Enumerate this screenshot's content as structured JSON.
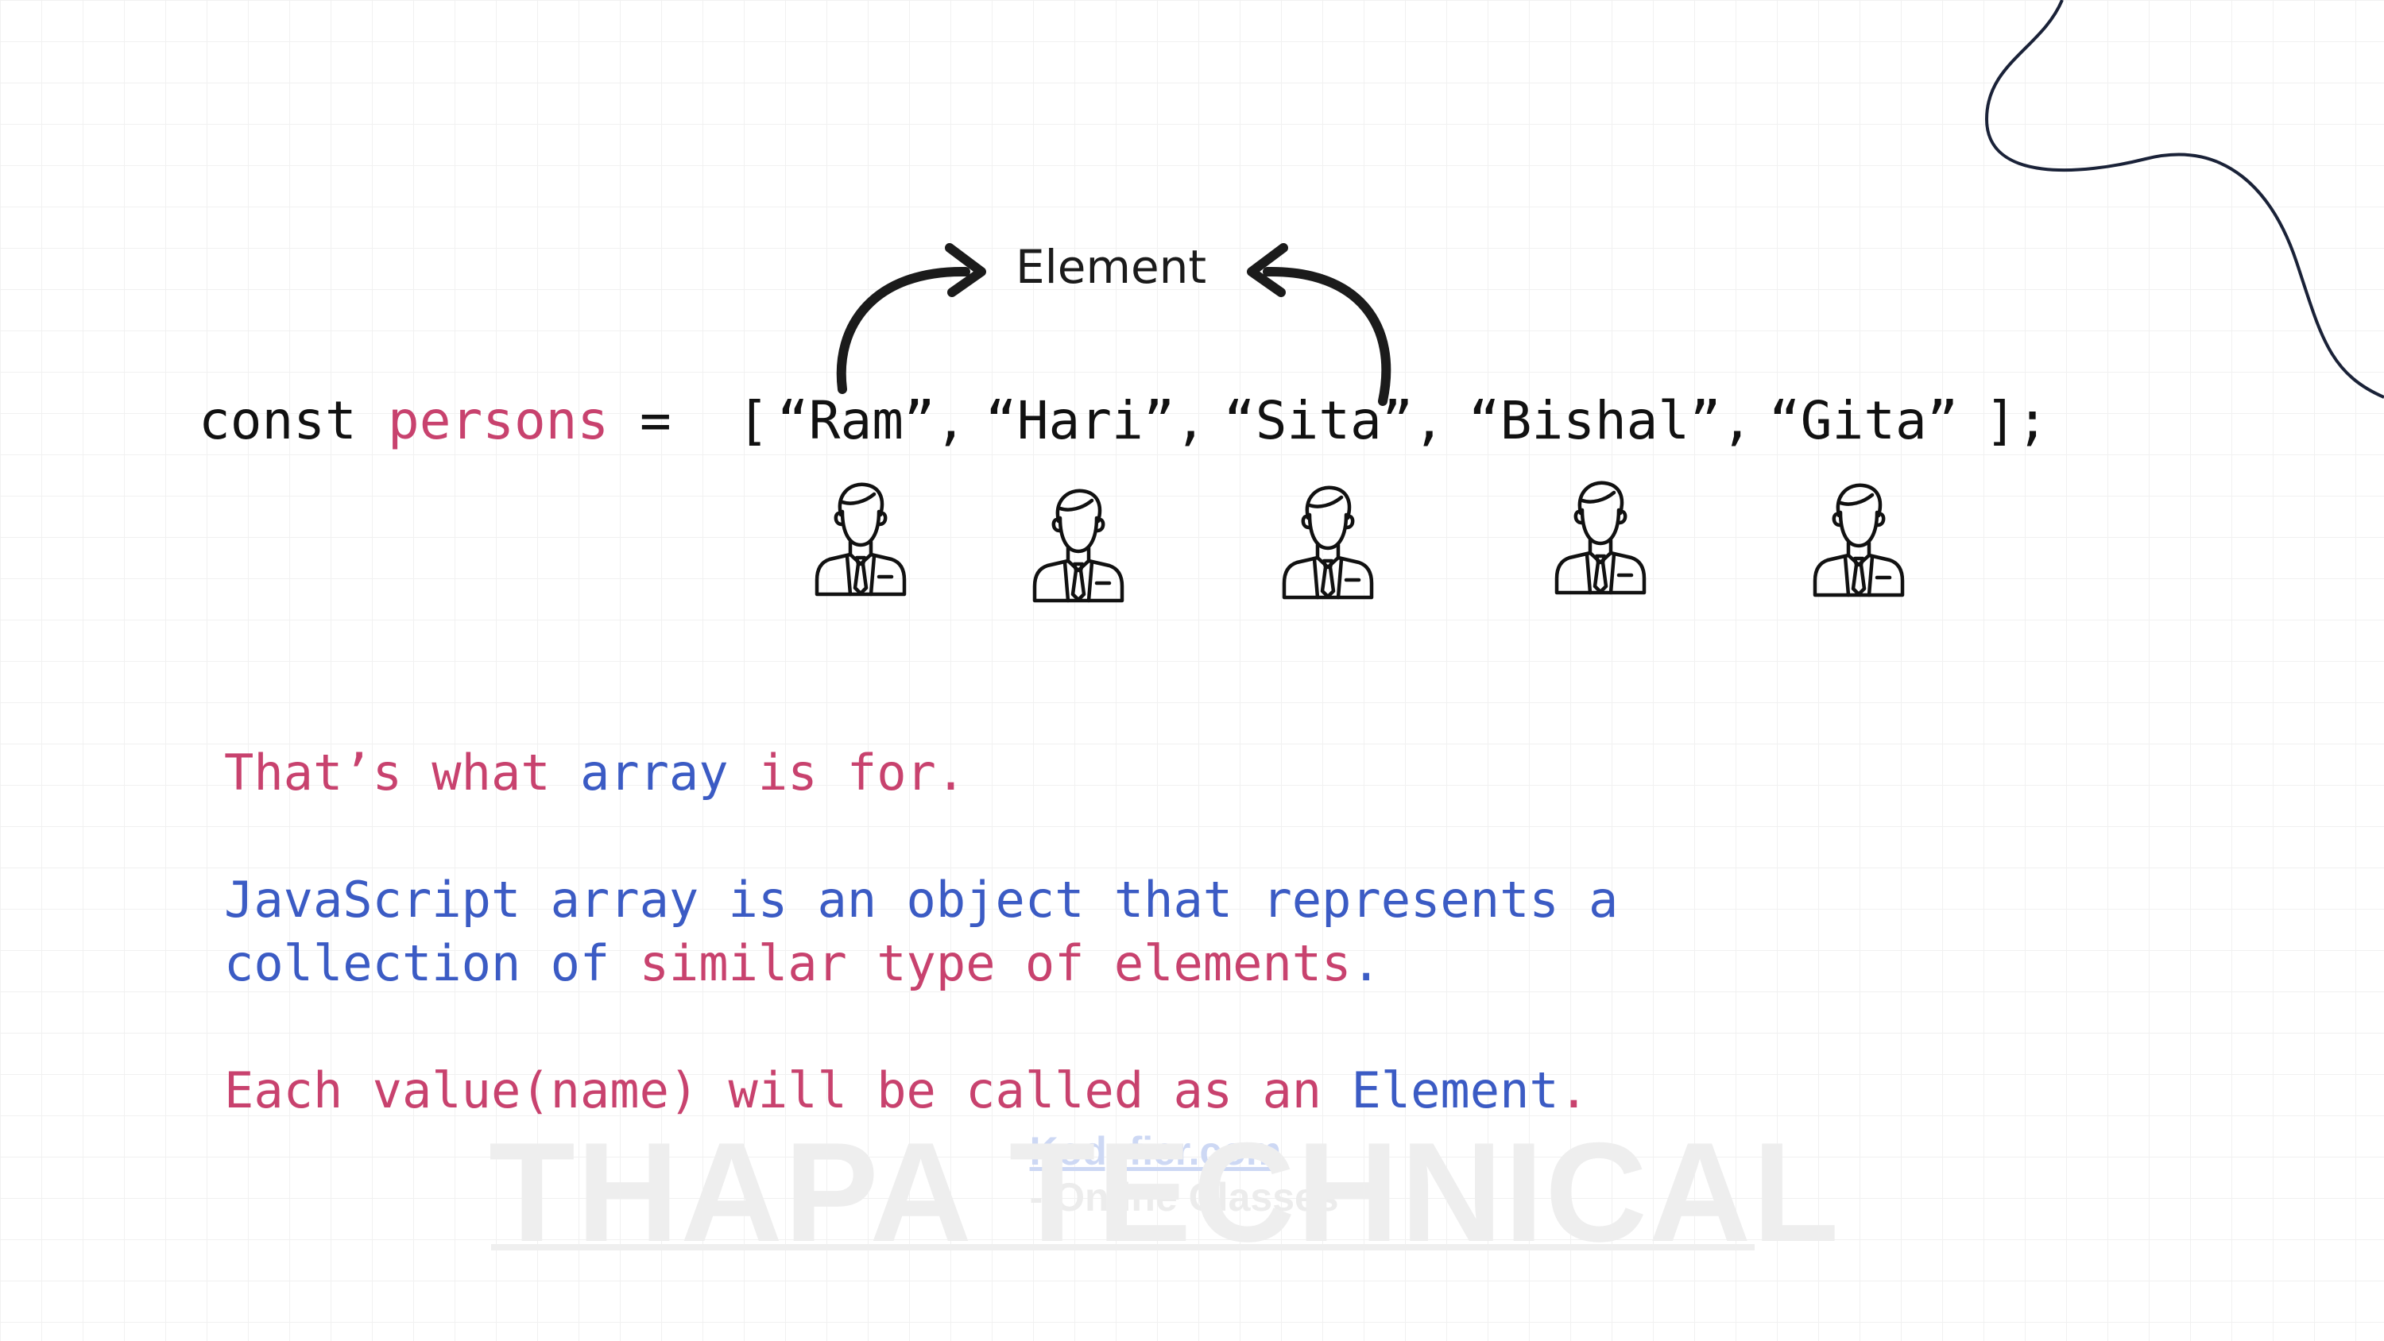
{
  "annotation": {
    "label": "Element"
  },
  "code_line": {
    "keyword": "const",
    "variable": "persons",
    "operator": "=",
    "open_bracket": "[",
    "items": [
      "“Ram”,",
      "“Hari”,",
      "“Sita”,",
      "“Bishal”,",
      "“Gita”"
    ],
    "close": "];"
  },
  "persons": [
    {
      "name": "Ram",
      "icon": "businessman-icon"
    },
    {
      "name": "Hari",
      "icon": "businessman-icon"
    },
    {
      "name": "Sita",
      "icon": "businessman-icon"
    },
    {
      "name": "Bishal",
      "icon": "businessman-icon"
    },
    {
      "name": "Gita",
      "icon": "businessman-icon"
    }
  ],
  "explanation": {
    "line1": {
      "a": "That’s what",
      "b": "array",
      "c": "is for."
    },
    "line2": "JavaScript array is an object that represents a",
    "line3": {
      "a": "collection of",
      "b": "similar type of elements",
      "c": "."
    },
    "line4": {
      "a": "Each value(name) will be called as an",
      "b": "Element",
      "c": "."
    }
  },
  "watermark": {
    "url": "Kodyfier.com",
    "tagline": "- Online Classes",
    "brand": "THAPA TECHNICAL"
  },
  "colors": {
    "pink": "#c8426e",
    "blue": "#3b5bc4",
    "text": "#111111",
    "curve": "#1a2238"
  }
}
